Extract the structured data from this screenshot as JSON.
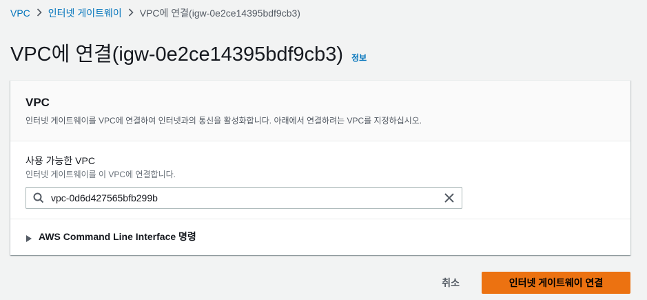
{
  "breadcrumb": {
    "items": [
      {
        "label": "VPC"
      },
      {
        "label": "인터넷 게이트웨이"
      },
      {
        "label": "VPC에 연결(igw-0e2ce14395bdf9cb3)"
      }
    ]
  },
  "page": {
    "title": "VPC에 연결(igw-0e2ce14395bdf9cb3)",
    "info_label": "정보"
  },
  "panel": {
    "title": "VPC",
    "description": "인터넷 게이트웨이를 VPC에 연결하여 인터넷과의 통신을 활성화합니다. 아래에서 연결하려는 VPC를 지정하십시오.",
    "field": {
      "label": "사용 가능한 VPC",
      "description": "인터넷 게이트웨이를 이 VPC에 연결합니다.",
      "value": "vpc-0d6d427565bfb299b"
    },
    "expander_label": "AWS Command Line Interface 명령"
  },
  "actions": {
    "cancel_label": "취소",
    "submit_label": "인터넷 게이트웨이 연결"
  },
  "colors": {
    "link": "#0073bb",
    "primary": "#ec7211",
    "background": "#f2f3f3"
  },
  "icons": {
    "breadcrumb_separator": "chevron-right-icon",
    "search": "search-icon",
    "clear": "close-icon",
    "expander": "caret-right-icon"
  }
}
